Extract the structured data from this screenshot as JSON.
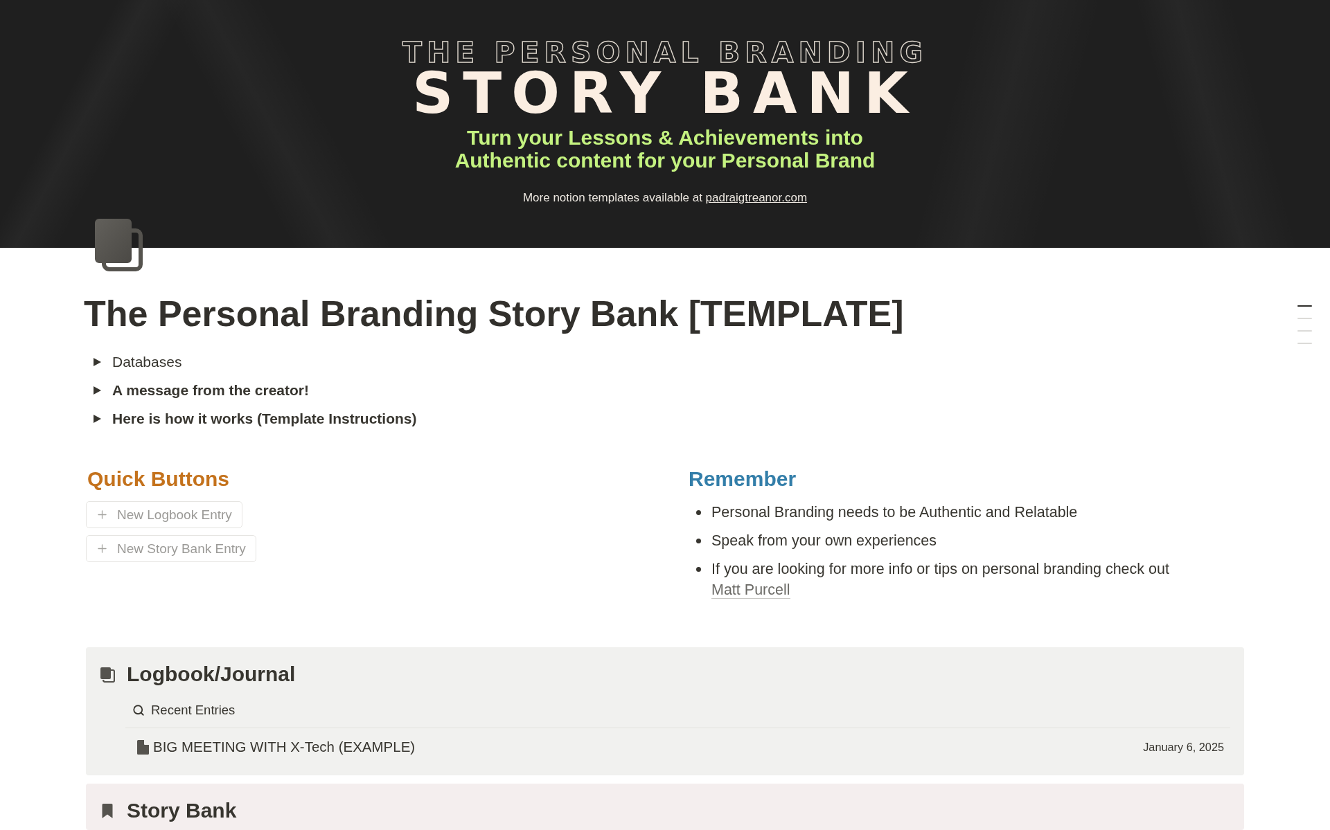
{
  "cover": {
    "kicker": "THE PERSONAL BRANDING",
    "title": "STORY BANK",
    "tagline": [
      "Turn your Lessons & Achievements into",
      "Authentic content for your Personal Brand"
    ],
    "note": "More notion templates available at",
    "link": "padraigtreanor.com"
  },
  "page": {
    "title": "The Personal Branding Story Bank [TEMPLATE]"
  },
  "toggles": [
    {
      "label": "Databases",
      "bold": false,
      "expanded": false
    },
    {
      "label": "A message from the creator!",
      "bold": true,
      "expanded": false
    },
    {
      "label": "Here is how it works (Template Instructions)",
      "bold": true,
      "expanded": false
    }
  ],
  "columns": [
    {
      "kind": "buttons",
      "heading": "Quick Buttons",
      "color": "#c4721c",
      "buttons": [
        "New Logbook Entry",
        "New Story Bank Entry"
      ]
    },
    {
      "kind": "bullets",
      "heading": "Remember",
      "color": "#337ea9",
      "bullets": [
        {
          "text": "Personal Branding needs to be Authentic and Relatable"
        },
        {
          "text": "Speak from your own experiences"
        },
        {
          "text": "If you are looking for more info or tips on personal branding check out",
          "link": "Matt Purcell"
        }
      ]
    }
  ],
  "databases": [
    {
      "kind": "logbook",
      "title": "Logbook/Journal",
      "color": "#f1f1ef",
      "view": "Recent Entries",
      "rows": [
        {
          "title": "BIG MEETING WITH X-Tech (EXAMPLE)",
          "date": "January 6, 2025"
        }
      ]
    },
    {
      "kind": "story",
      "title": "Story Bank",
      "color": "#f4eeee"
    }
  ],
  "outline": [
    {
      "selected": true
    },
    {
      "selected": false
    },
    {
      "selected": false
    },
    {
      "selected": false
    }
  ]
}
